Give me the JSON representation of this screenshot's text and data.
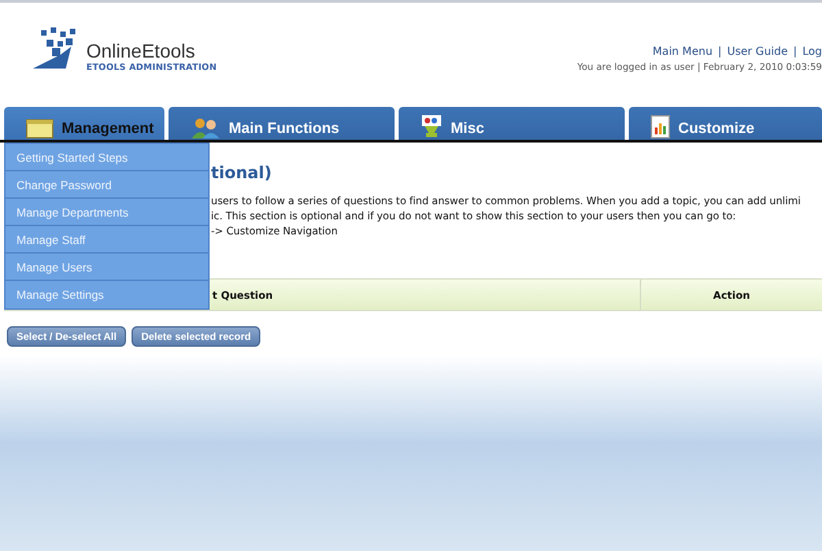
{
  "header": {
    "logo": {
      "name": "OnlineEtools",
      "subtitle": "ETOOLS ADMINISTRATION"
    },
    "links": [
      "Main Menu",
      "User Guide",
      "Log"
    ],
    "link_separator": "|",
    "login_info": "You are logged in as user | February 2, 2010 0:03:59"
  },
  "tabs": [
    {
      "label": "Management",
      "selected": true
    },
    {
      "label": "Main Functions",
      "selected": false
    },
    {
      "label": "Misc",
      "selected": false
    },
    {
      "label": "Customize",
      "selected": false
    }
  ],
  "dropdown_menu": [
    "Getting Started Steps",
    "Change Password",
    "Manage Departments",
    "Manage Staff",
    "Manage Users",
    "Manage Settings"
  ],
  "content": {
    "title": "tional)",
    "paragraph_lines": [
      "users to follow a series of questions to find answer to common problems. When you add a topic, you can add unlimi",
      "ic. This section is optional and if you do not want to show this section to your users then you can go to:",
      "-> Customize Navigation"
    ]
  },
  "table": {
    "columns": [
      "t Question",
      "Action"
    ]
  },
  "buttons": [
    "Select / De-select All",
    "Delete selected record"
  ]
}
